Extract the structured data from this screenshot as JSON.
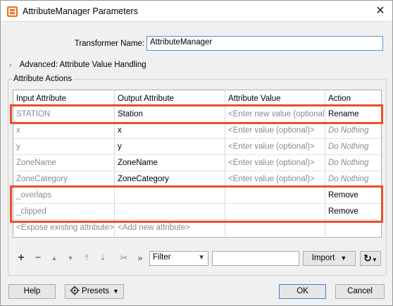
{
  "window": {
    "title": "AttributeManager Parameters",
    "close_glyph": "✕"
  },
  "transformer": {
    "label": "Transformer Name:",
    "value": "AttributeManager"
  },
  "advanced": {
    "chevron": "›",
    "label": "Advanced: Attribute Value Handling"
  },
  "actions_group": {
    "label": "Attribute Actions"
  },
  "table": {
    "headers": [
      "Input Attribute",
      "Output Attribute",
      "Attribute Value",
      "Action"
    ],
    "rows": [
      {
        "input": "STATION",
        "output": "Station",
        "value": "<Enter new value (optional)>",
        "action": "Rename"
      },
      {
        "input": "x",
        "output": "x",
        "value": "<Enter value (optional)>",
        "action": "Do Nothing"
      },
      {
        "input": "y",
        "output": "y",
        "value": "<Enter value (optional)>",
        "action": "Do Nothing"
      },
      {
        "input": "ZoneName",
        "output": "ZoneName",
        "value": "<Enter value (optional)>",
        "action": "Do Nothing"
      },
      {
        "input": "ZoneCategory",
        "output": "ZoneCategory",
        "value": "<Enter value (optional)>",
        "action": "Do Nothing"
      },
      {
        "input": "_overlaps",
        "output": "",
        "value": "",
        "action": "Remove"
      },
      {
        "input": "_clipped",
        "output": "",
        "value": "",
        "action": "Remove"
      },
      {
        "input": "<Expose existing attribute>",
        "output": "<Add new attribute>",
        "value": "",
        "action": ""
      }
    ]
  },
  "toolbar": {
    "add": "+",
    "remove": "−",
    "up": "▲",
    "down": "▼",
    "top": "⤒",
    "bottom": "⤓",
    "cut": "✂",
    "more": "»",
    "filter_value": "Filter",
    "dropdown": "▼",
    "import_label": "Import",
    "refresh": "↻"
  },
  "footer": {
    "help": "Help",
    "presets": "Presets",
    "ok": "OK",
    "cancel": "Cancel"
  },
  "colors": {
    "highlight": "#e8502b",
    "brand": "#e8742a"
  }
}
